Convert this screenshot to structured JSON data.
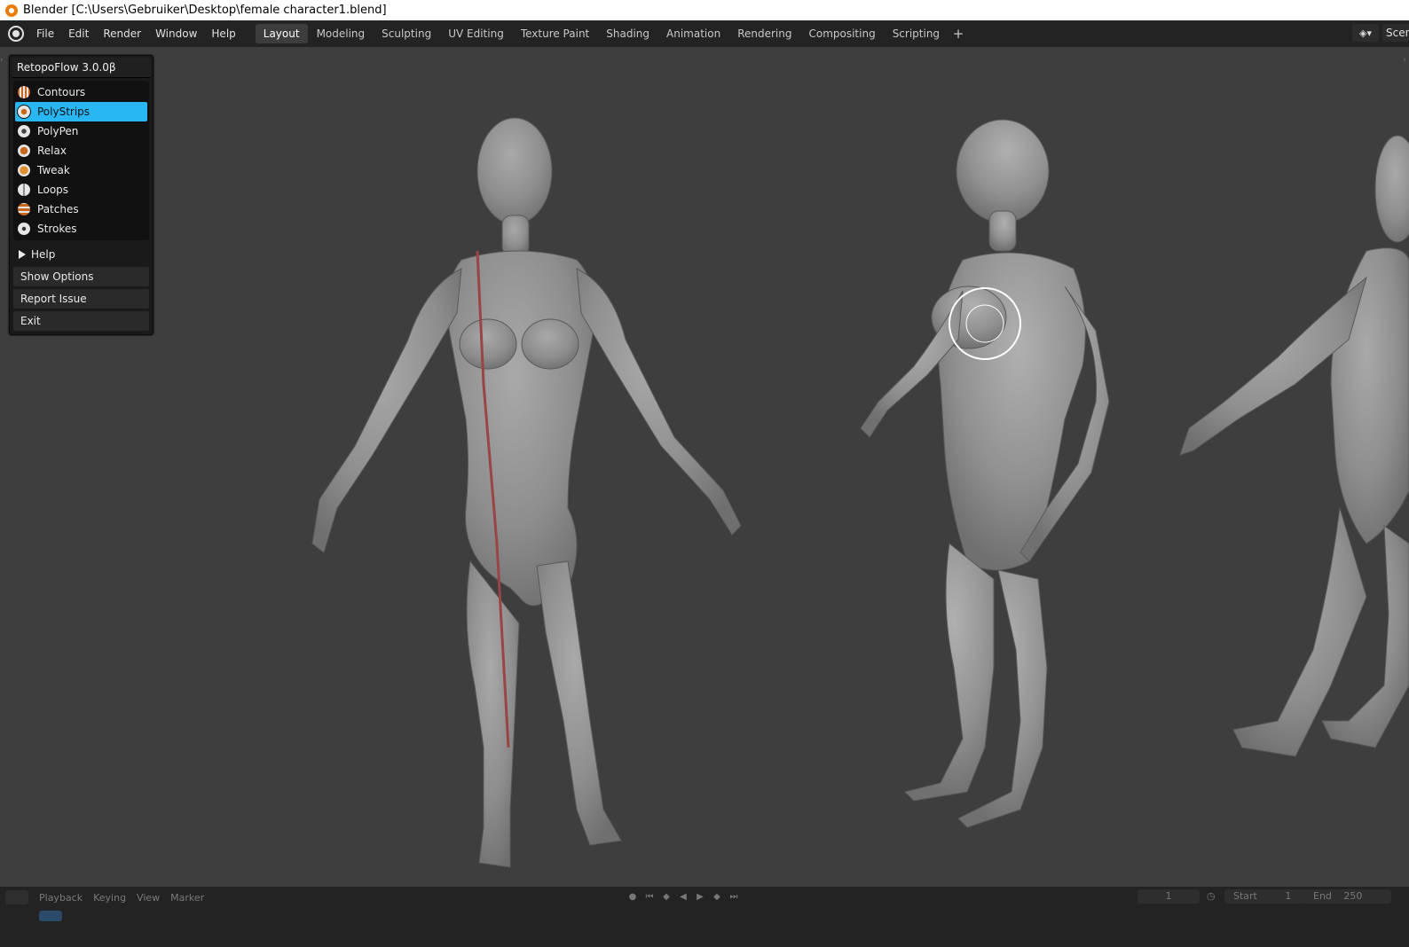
{
  "window": {
    "title": "Blender [C:\\Users\\Gebruiker\\Desktop\\female character1.blend]"
  },
  "menu": {
    "items": [
      "File",
      "Edit",
      "Render",
      "Window",
      "Help"
    ]
  },
  "workspaces": {
    "tabs": [
      "Layout",
      "Modeling",
      "Sculpting",
      "UV Editing",
      "Texture Paint",
      "Shading",
      "Animation",
      "Rendering",
      "Compositing",
      "Scripting"
    ],
    "active": "Layout",
    "add_label": "+"
  },
  "scene": {
    "label": "Scene"
  },
  "retopoflow": {
    "title": "RetopoFlow 3.0.0β",
    "tools": [
      {
        "label": "Contours",
        "icon": "contours-icon"
      },
      {
        "label": "PolyStrips",
        "icon": "polystrips-icon",
        "active": true
      },
      {
        "label": "PolyPen",
        "icon": "polypen-icon"
      },
      {
        "label": "Relax",
        "icon": "relax-icon"
      },
      {
        "label": "Tweak",
        "icon": "tweak-icon"
      },
      {
        "label": "Loops",
        "icon": "loops-icon"
      },
      {
        "label": "Patches",
        "icon": "patches-icon"
      },
      {
        "label": "Strokes",
        "icon": "strokes-icon"
      }
    ],
    "help_label": "Help",
    "show_options_label": "Show Options",
    "report_issue_label": "Report Issue",
    "exit_label": "Exit",
    "accent": "#29b7f4"
  },
  "timeline": {
    "playback_label": "Playback",
    "keying_label": "Keying",
    "view_label": "View",
    "marker_label": "Marker",
    "current_frame": "1",
    "start_label": "Start",
    "start_value": "1",
    "end_label": "End",
    "end_value": "250"
  }
}
